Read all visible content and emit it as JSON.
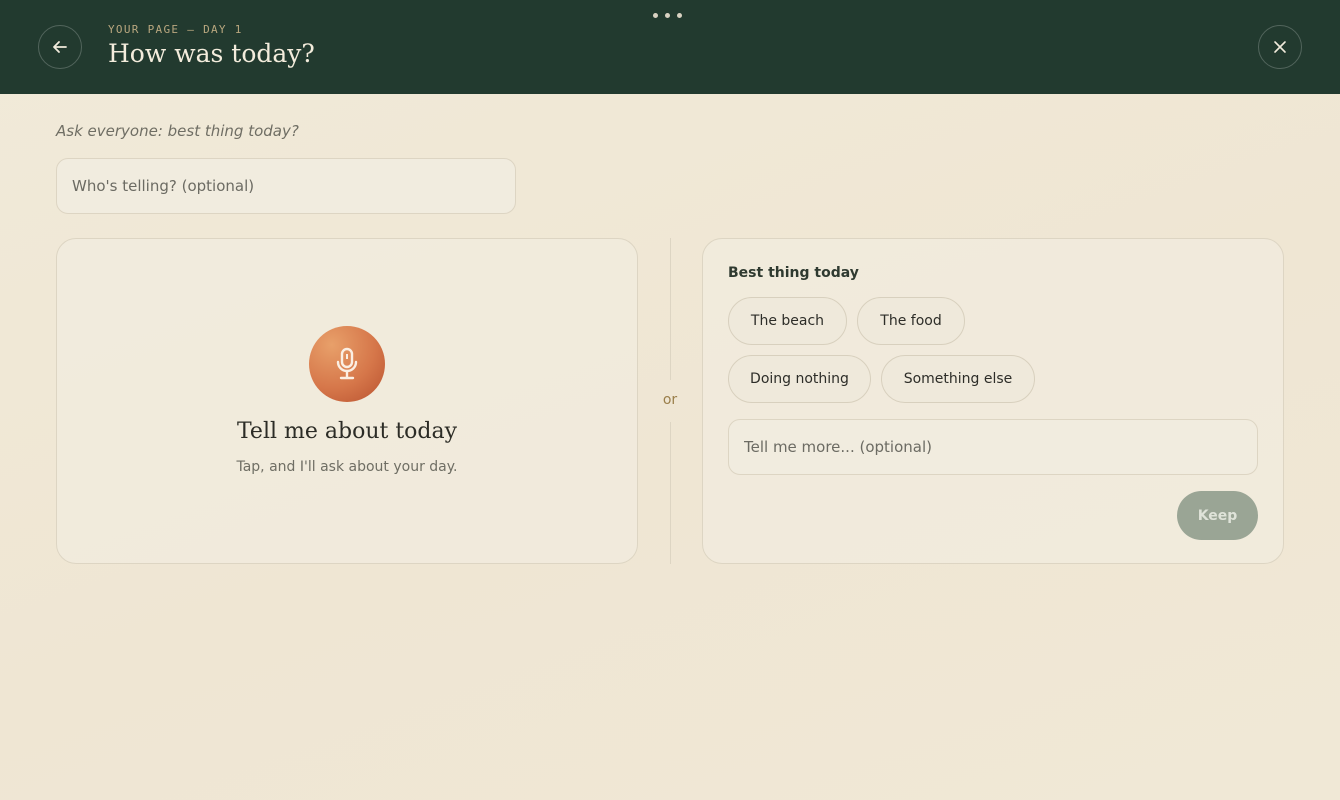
{
  "header": {
    "eyebrow": "YOUR PAGE — DAY 1",
    "title": "How was today?",
    "back_icon": "arrow-left-icon",
    "close_icon": "close-icon",
    "menu_icon": "more-dots-icon"
  },
  "prompt": "Ask everyone: best thing today?",
  "teller": {
    "placeholder": "Who's telling? (optional)",
    "value": ""
  },
  "voice": {
    "icon": "microphone-icon",
    "title": "Tell me about today",
    "subtitle": "Tap, and I'll ask about your day."
  },
  "divider": {
    "label": "or"
  },
  "choices": {
    "heading": "Best thing today",
    "options": [
      "The beach",
      "The food",
      "Doing nothing",
      "Something else"
    ],
    "more_placeholder": "Tell me more... (optional)",
    "keep_label": "Keep"
  },
  "colors": {
    "header_bg": "#223a2f",
    "accent_mic": "#d6774a",
    "keep_disabled": "#9aa595",
    "page_bg": "#f0e8d6"
  }
}
